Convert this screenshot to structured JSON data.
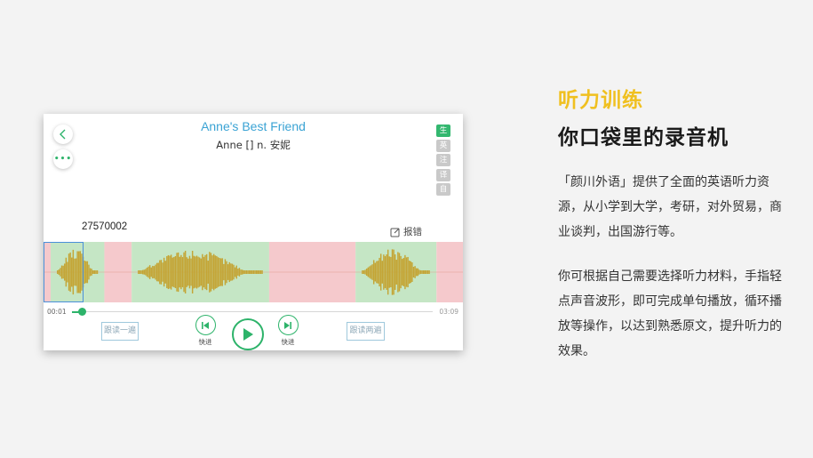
{
  "app": {
    "title": "Anne's Best Friend",
    "word_line": "Anne [] n. 安妮",
    "side_tabs": [
      {
        "label": "生",
        "active": true
      },
      {
        "label": "英",
        "active": false
      },
      {
        "label": "注",
        "active": false
      },
      {
        "label": "译",
        "active": false
      },
      {
        "label": "自",
        "active": false
      }
    ],
    "sentence_id": "27570002",
    "report_label": "报错",
    "waveform_segments": [
      {
        "state": "red",
        "frac": 0.017
      },
      {
        "state": "green",
        "frac": 0.128
      },
      {
        "state": "red",
        "frac": 0.065
      },
      {
        "state": "green",
        "frac": 0.328
      },
      {
        "state": "red",
        "frac": 0.206
      },
      {
        "state": "green",
        "frac": 0.193
      },
      {
        "state": "red",
        "frac": 0.063
      }
    ],
    "playback": {
      "current_time": "00:01",
      "total_time": "03:09",
      "progress": 0.02
    },
    "buttons": {
      "follow_once": "跟读一遍",
      "follow_twice": "跟读两遍",
      "rewind_label": "快进",
      "forward_label": "快进"
    },
    "colors": {
      "accent_green": "#2db36a",
      "title_blue": "#3aa3d4",
      "wave_gold": "#c4a535",
      "seg_green": "#c5e6c5",
      "seg_red": "#f5c9cc"
    }
  },
  "promo": {
    "headline_colored": "听力训练",
    "headline_main": "你口袋里的录音机",
    "paragraph1": "「颜川外语」提供了全面的英语听力资源，从小学到大学，考研，对外贸易，商业谈判，出国游行等。",
    "paragraph2": "你可根据自己需要选择听力材料，手指轻点声音波形，即可完成单句播放，循环播放等操作，以达到熟悉原文，提升听力的效果。"
  }
}
